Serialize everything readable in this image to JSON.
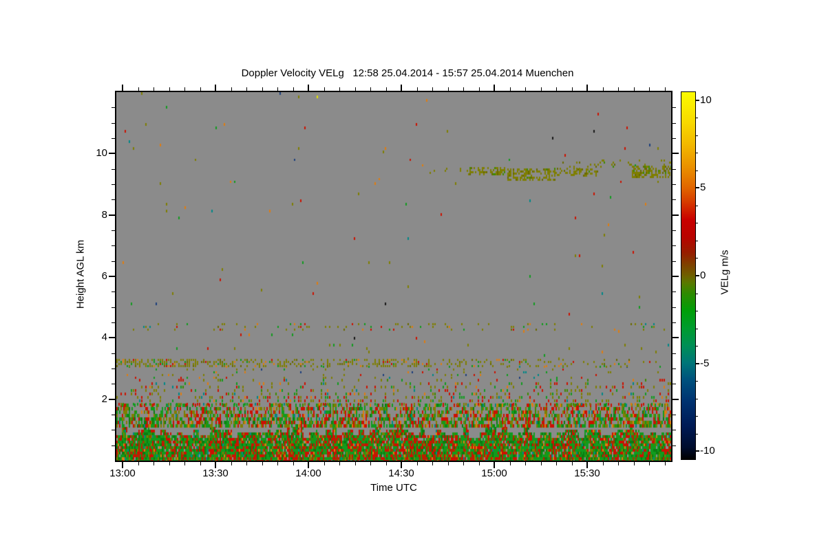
{
  "chart_data": {
    "type": "heatmap",
    "title": "Doppler Velocity VELg   12:58 25.04.2014 - 15:57 25.04.2014 Muenchen",
    "xlabel": "Time UTC",
    "ylabel": "Height AGL km",
    "x_range_minutes": [
      778,
      957
    ],
    "x_major_ticks_minutes": [
      780,
      810,
      840,
      870,
      900,
      930
    ],
    "x_tick_labels": [
      "13:00",
      "13:30",
      "14:00",
      "14:30",
      "15:00",
      "15:30"
    ],
    "x_minor_step_minutes": 5,
    "y_range_km": [
      0,
      12
    ],
    "y_major_ticks": [
      2,
      4,
      6,
      8,
      10
    ],
    "y_tick_labels": [
      "2",
      "4",
      "6",
      "8",
      "10"
    ],
    "y_minor_step": 0.5,
    "background": "#8b8b8b",
    "grid": false,
    "seed": 20140425,
    "colorbar": {
      "label": "VELg m/s",
      "range": [
        -10.5,
        10.5
      ],
      "ticks": [
        10,
        5,
        0,
        -5,
        -10
      ],
      "tick_labels": [
        "10",
        "5",
        "0",
        "-5",
        "-10"
      ],
      "minor_tick_step": 1,
      "stops": [
        [
          -10.5,
          "#000000"
        ],
        [
          -9.8,
          "#000d2e"
        ],
        [
          -8.6,
          "#001a55"
        ],
        [
          -7.2,
          "#003270"
        ],
        [
          -6.0,
          "#00507d"
        ],
        [
          -5.0,
          "#007578"
        ],
        [
          -4.0,
          "#008f55"
        ],
        [
          -3.0,
          "#009c2e"
        ],
        [
          -2.0,
          "#009e08"
        ],
        [
          -1.0,
          "#2f8a00"
        ],
        [
          -0.4,
          "#5a7800"
        ],
        [
          0.0,
          "#6f6000"
        ],
        [
          0.6,
          "#7e4200"
        ],
        [
          1.3,
          "#961e00"
        ],
        [
          2.2,
          "#b80300"
        ],
        [
          3.2,
          "#c90000"
        ],
        [
          4.2,
          "#d63a00"
        ],
        [
          5.0,
          "#e06400"
        ],
        [
          6.2,
          "#ea9000"
        ],
        [
          7.5,
          "#f2b800"
        ],
        [
          8.8,
          "#f8da00"
        ],
        [
          10.5,
          "#fbfb00"
        ]
      ]
    },
    "bands": [
      {
        "km": [
          0,
          1.18
        ],
        "density": [
          0.88,
          0.97
        ],
        "cell": [
          2,
          4,
          2,
          4
        ],
        "clumpy": true,
        "topJitterKm": 0.38,
        "palette": [
          [
            "#119b1e",
            0.4
          ],
          [
            "#0b7d11",
            0.14
          ],
          [
            "#cc1100",
            0.24,
            "r"
          ],
          [
            "#a83000",
            0.06,
            "r"
          ],
          [
            "#7e7e00",
            0.08
          ],
          [
            "#df7d10",
            0.03,
            "r"
          ],
          [
            "#3f8a00",
            0.03
          ],
          [
            "#008787",
            0.02
          ]
        ]
      },
      {
        "km": [
          1.18,
          1.85
        ],
        "density": [
          0.42,
          0.72
        ],
        "cell": [
          2,
          5,
          2,
          5
        ],
        "clumpy": true,
        "palette": [
          [
            "#119b1e",
            0.3
          ],
          [
            "#7e7e00",
            0.25
          ],
          [
            "#cc1100",
            0.24,
            "r"
          ],
          [
            "#0b7d11",
            0.08
          ],
          [
            "#df7d10",
            0.05,
            "r"
          ],
          [
            "#3f8a00",
            0.05
          ],
          [
            "#008787",
            0.03
          ]
        ]
      },
      {
        "km": [
          1.85,
          2.65
        ],
        "density": [
          0.1,
          0.4
        ],
        "cell": [
          3,
          5,
          2,
          4
        ],
        "clumpy": true,
        "palette": [
          [
            "#7e7e00",
            0.38
          ],
          [
            "#cc1100",
            0.22,
            "r"
          ],
          [
            "#119b1e",
            0.2
          ],
          [
            "#df7d10",
            0.08,
            "r"
          ],
          [
            "#3f8a00",
            0.07
          ],
          [
            "#008787",
            0.05
          ]
        ]
      },
      {
        "km": [
          2.65,
          3.08
        ],
        "density": [
          0.05,
          0.09
        ],
        "cell": [
          3,
          4,
          2,
          3
        ],
        "palette": [
          [
            "#7e7e00",
            0.5
          ],
          [
            "#119b1e",
            0.18
          ],
          [
            "#cc1100",
            0.12
          ],
          [
            "#df7d10",
            0.1
          ],
          [
            "#008787",
            0.05
          ],
          [
            "#1c3f7d",
            0.05
          ]
        ]
      },
      {
        "km": [
          3.1,
          3.3
        ],
        "density": [
          0.5,
          0.5
        ],
        "cell": [
          3,
          3,
          2,
          3
        ],
        "xprofile": [
          1.15,
          0.18
        ],
        "palette": [
          [
            "#7e7e00",
            0.68
          ],
          [
            "#6a6a00",
            0.1
          ],
          [
            "#119b1e",
            0.08
          ],
          [
            "#cc1100",
            0.06
          ],
          [
            "#df7d10",
            0.08
          ]
        ]
      },
      {
        "km": [
          3.32,
          4.25
        ],
        "density": [
          0.015,
          0.015
        ],
        "cell": [
          3,
          5,
          2,
          4
        ],
        "palette": [
          [
            "#7e7e00",
            0.35
          ],
          [
            "#119b1e",
            0.18
          ],
          [
            "#cc1100",
            0.12
          ],
          [
            "#df7d10",
            0.12
          ],
          [
            "#008787",
            0.08
          ],
          [
            "#1c3f7d",
            0.07
          ],
          [
            "#e3e300",
            0.04
          ],
          [
            "#161616",
            0.04
          ]
        ]
      },
      {
        "km": [
          4.28,
          4.47
        ],
        "density": [
          0.14,
          0.14
        ],
        "cell": [
          3,
          4,
          2,
          3
        ],
        "palette": [
          [
            "#7e7e00",
            0.55
          ],
          [
            "#119b1e",
            0.14
          ],
          [
            "#cc1100",
            0.1
          ],
          [
            "#df7d10",
            0.1
          ],
          [
            "#008787",
            0.06
          ],
          [
            "#6a6a00",
            0.05
          ]
        ]
      },
      {
        "km": [
          4.5,
          9.05
        ],
        "density": [
          0.006,
          0.006
        ],
        "cell": [
          3,
          5,
          2,
          4
        ],
        "palette": [
          [
            "#7e7e00",
            0.3
          ],
          [
            "#119b1e",
            0.17
          ],
          [
            "#cc1100",
            0.12
          ],
          [
            "#df7d10",
            0.12
          ],
          [
            "#008787",
            0.1
          ],
          [
            "#1c3f7d",
            0.08
          ],
          [
            "#e3e300",
            0.06
          ],
          [
            "#161616",
            0.05
          ]
        ]
      },
      {
        "km": [
          9.05,
          9.9
        ],
        "density": [
          0.005,
          0.005
        ],
        "cell": [
          3,
          4,
          2,
          3
        ],
        "palette": [
          [
            "#7e7e00",
            0.3
          ],
          [
            "#119b1e",
            0.17
          ],
          [
            "#cc1100",
            0.12
          ],
          [
            "#df7d10",
            0.12
          ],
          [
            "#008787",
            0.1
          ],
          [
            "#1c3f7d",
            0.08
          ],
          [
            "#e3e300",
            0.06
          ],
          [
            "#161616",
            0.05
          ]
        ]
      },
      {
        "km": [
          9.9,
          12
        ],
        "density": [
          0.0045,
          0.0045
        ],
        "cell": [
          3,
          5,
          2,
          4
        ],
        "palette": [
          [
            "#7e7e00",
            0.3
          ],
          [
            "#119b1e",
            0.17
          ],
          [
            "#cc1100",
            0.12
          ],
          [
            "#df7d10",
            0.12
          ],
          [
            "#008787",
            0.1
          ],
          [
            "#1c3f7d",
            0.08
          ],
          [
            "#e3e300",
            0.06
          ],
          [
            "#161616",
            0.05
          ]
        ]
      }
    ],
    "clouds": {
      "cell": [
        2,
        3,
        2,
        3
      ],
      "palette": [
        [
          "#7e7e00",
          0.78
        ],
        [
          "#6a6a00",
          0.14
        ],
        [
          "#3f8a00",
          0.08
        ]
      ],
      "clusters": [
        [
          0.56,
          0.635,
          9.38,
          9.52,
          0.1
        ],
        [
          0.635,
          0.7,
          9.3,
          9.55,
          0.45
        ],
        [
          0.705,
          0.79,
          9.15,
          9.5,
          0.52
        ],
        [
          0.79,
          0.835,
          9.28,
          9.52,
          0.3
        ],
        [
          0.8,
          0.88,
          9.55,
          9.72,
          0.13
        ],
        [
          0.825,
          0.868,
          9.3,
          9.5,
          0.38
        ],
        [
          0.865,
          1.0,
          9.58,
          9.8,
          0.13
        ],
        [
          0.93,
          1.0,
          9.26,
          9.6,
          0.52
        ]
      ]
    }
  }
}
